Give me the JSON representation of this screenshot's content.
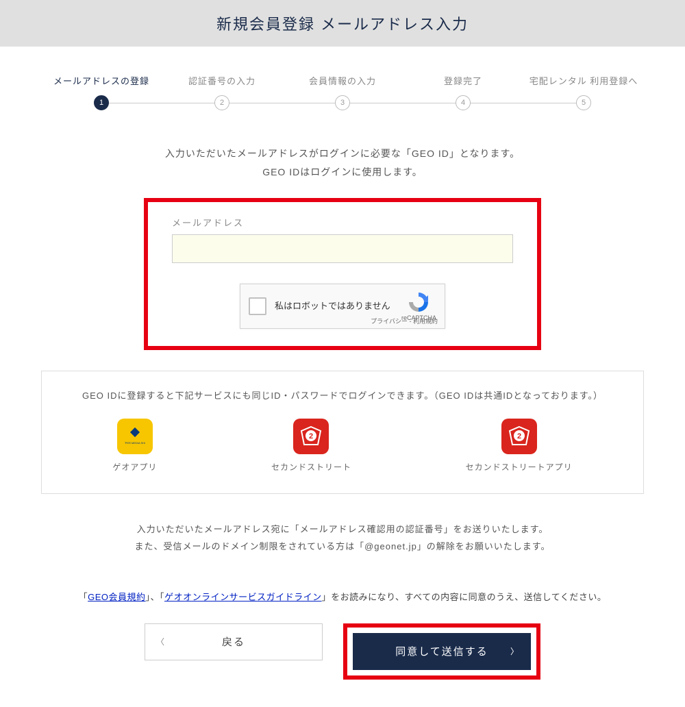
{
  "header": {
    "title": "新規会員登録 メールアドレス入力"
  },
  "steps": [
    {
      "label": "メールアドレスの登録",
      "num": "1",
      "active": true
    },
    {
      "label": "認証番号の入力",
      "num": "2",
      "active": false
    },
    {
      "label": "会員情報の入力",
      "num": "3",
      "active": false
    },
    {
      "label": "登録完了",
      "num": "4",
      "active": false
    },
    {
      "label": "宅配レンタル 利用登録へ",
      "num": "5",
      "active": false
    }
  ],
  "intro": {
    "line1": "入力いただいたメールアドレスがログインに必要な「GEO ID」となります。",
    "line2": "GEO IDはログインに使用します。"
  },
  "form": {
    "email_label": "メールアドレス",
    "email_value": ""
  },
  "recaptcha": {
    "text": "私はロボットではありません",
    "brand": "reCAPTCHA",
    "links": "プライバシー - 利用規約"
  },
  "services": {
    "intro": "GEO IDに登録すると下記サービスにも同じID・パスワードでログインできます。（GEO IDは共通IDとなっております。）",
    "items": [
      {
        "name": "ゲオアプリ",
        "icon": "geo-app-icon",
        "color": "yellow"
      },
      {
        "name": "セカンドストリート",
        "icon": "second-street-icon",
        "color": "red"
      },
      {
        "name": "セカンドストリートアプリ",
        "icon": "second-street-app-icon",
        "color": "red"
      }
    ]
  },
  "notes": {
    "line1": "入力いただいたメールアドレス宛に「メールアドレス確認用の認証番号」をお送りいたします。",
    "line2": "また、受信メールのドメイン制限をされている方は「@geonet.jp」の解除をお願いいたします。"
  },
  "terms": {
    "prefix": "「",
    "link1": "GEO会員規約",
    "mid1": "」、「",
    "link2": "ゲオオンラインサービスガイドライン",
    "suffix": "」をお読みになり、すべての内容に同意のうえ、送信してください。"
  },
  "buttons": {
    "back": "戻る",
    "submit": "同意して送信する"
  }
}
